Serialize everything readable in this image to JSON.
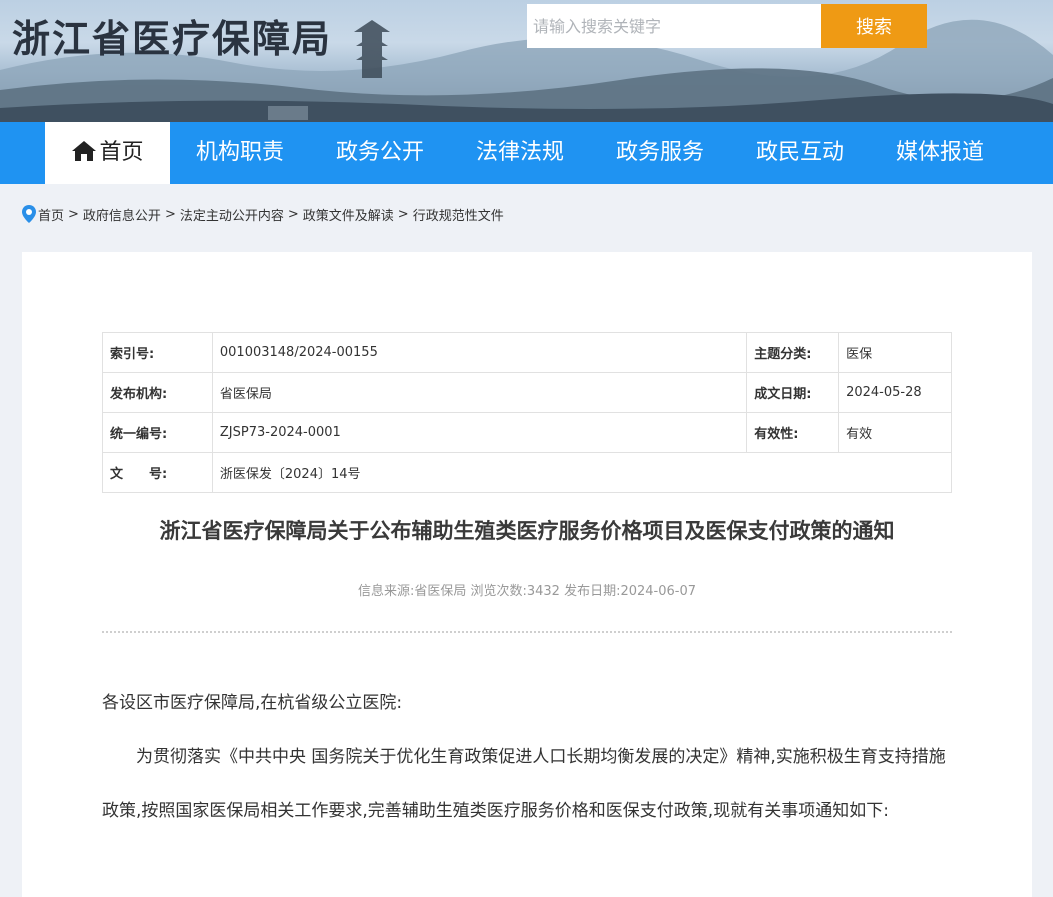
{
  "header": {
    "site_title": "浙江省医疗保障局",
    "search": {
      "placeholder": "请输入搜索关键字",
      "button_label": "搜索"
    }
  },
  "nav": {
    "items": [
      {
        "label": "首页",
        "active": true
      },
      {
        "label": "机构职责"
      },
      {
        "label": "政务公开"
      },
      {
        "label": "法律法规"
      },
      {
        "label": "政务服务"
      },
      {
        "label": "政民互动"
      },
      {
        "label": "媒体报道"
      }
    ]
  },
  "breadcrumb": [
    "首页",
    "政府信息公开",
    "法定主动公开内容",
    "政策文件及解读",
    "行政规范性文件"
  ],
  "meta": {
    "index_label": "索引号:",
    "index_value": "001003148/2024-00155",
    "topic_label": "主题分类:",
    "topic_value": "医保",
    "publisher_label": "发布机构:",
    "publisher_value": "省医保局",
    "created_label": "成文日期:",
    "created_value": "2024-05-28",
    "code_label": "统一编号:",
    "code_value": "ZJSP73-2024-0001",
    "validity_label": "有效性:",
    "validity_value": "有效",
    "docno_label": "文　　号:",
    "docno_value": "浙医保发〔2024〕14号"
  },
  "article": {
    "title": "浙江省医疗保障局关于公布辅助生殖类医疗服务价格项目及医保支付政策的通知",
    "info": "信息来源:省医保局 浏览次数:3432 发布日期:2024-06-07",
    "salutation": "各设区市医疗保障局,在杭省级公立医院:",
    "body": "为贯彻落实《中共中央 国务院关于优化生育政策促进人口长期均衡发展的决定》精神,实施积极生育支持措施政策,按照国家医保局相关工作要求,完善辅助生殖类医疗服务价格和医保支付政策,现就有关事项通知如下:"
  },
  "colors": {
    "nav_bg": "#1f93f2",
    "search_button": "#ef9a14"
  }
}
